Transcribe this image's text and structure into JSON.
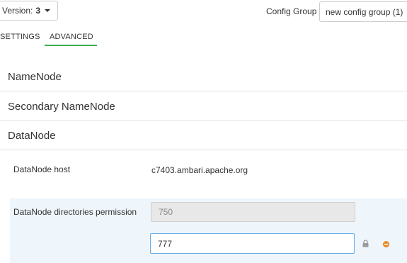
{
  "toolbar": {
    "version_label": "Version:",
    "version_value": "3",
    "config_group_label": "Config Group",
    "config_group_value": "new config group (1)"
  },
  "tabs": [
    {
      "label": "SETTINGS",
      "active": false
    },
    {
      "label": "ADVANCED",
      "active": true
    }
  ],
  "sections": [
    {
      "title": "NameNode"
    },
    {
      "title": "Secondary NameNode"
    },
    {
      "title": "DataNode"
    }
  ],
  "datanode": {
    "host_label": "DataNode host",
    "host_value": "c7403.ambari.apache.org",
    "dir_perm_label": "DataNode directories permission",
    "dir_perm_default_value": "750",
    "dir_perm_override_value": "777"
  },
  "icons": {
    "lock": "lock-icon",
    "remove": "remove-override-icon"
  },
  "colors": {
    "tab_active_underline": "#3fae49",
    "override_panel_bg": "#eef5fb",
    "input_focus_border": "#66afe9",
    "remove_icon": "#e98a24"
  }
}
